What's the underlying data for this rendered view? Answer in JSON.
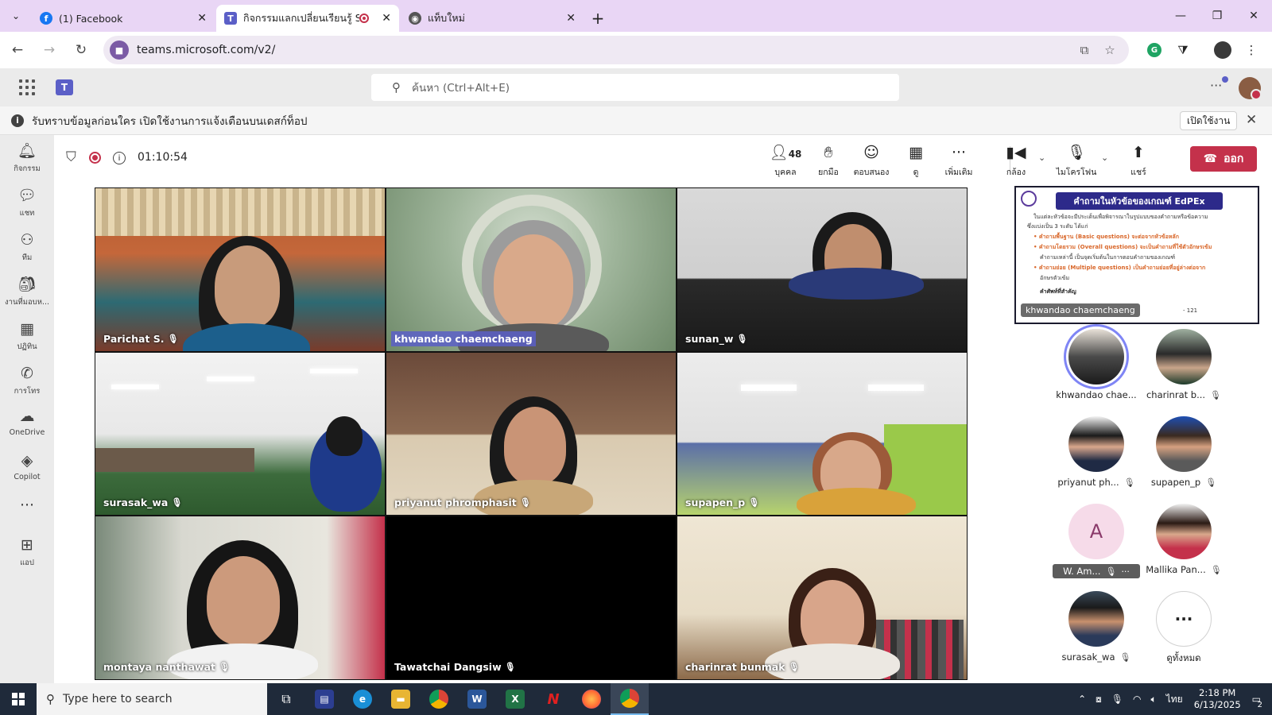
{
  "browser": {
    "tabs": [
      {
        "title": "(1) Facebook",
        "favicon": "facebook-icon"
      },
      {
        "title": "กิจกรรมแลกเปลี่ยนเรียนรู้ SAR",
        "favicon": "teams-icon"
      },
      {
        "title": "แท็บใหม่",
        "favicon": "chrome-icon"
      }
    ],
    "url": "teams.microsoft.com/v2/"
  },
  "teams": {
    "search_placeholder": "ค้นหา (Ctrl+Alt+E)"
  },
  "notification": {
    "text": "รับทราบข้อมูลก่อนใคร เปิดใช้งานการแจ้งเตือนบนเดสก์ท็อป",
    "enable_label": "เปิดใช้งาน"
  },
  "rail": [
    {
      "label": "กิจกรรม",
      "icon": "bell-icon"
    },
    {
      "label": "แชท",
      "icon": "chat-icon"
    },
    {
      "label": "ทีม",
      "icon": "teams-group-icon"
    },
    {
      "label": "งานที่มอบห...",
      "icon": "assignments-icon"
    },
    {
      "label": "ปฏิทิน",
      "icon": "calendar-icon"
    },
    {
      "label": "การโทร",
      "icon": "phone-icon"
    },
    {
      "label": "OneDrive",
      "icon": "cloud-icon"
    },
    {
      "label": "Copilot",
      "icon": "copilot-icon"
    },
    {
      "label": "แอป",
      "icon": "add-app-icon"
    }
  ],
  "meeting": {
    "timer": "01:10:54",
    "people_count": "48",
    "tools": {
      "people": "บุคคล",
      "raise": "ยกมือ",
      "react": "ตอบสนอง",
      "view": "ดู",
      "more": "เพิ่มเติม",
      "camera": "กล้อง",
      "mic": "ไมโครโฟน",
      "share": "แชร์",
      "leave": "ออก"
    },
    "tiles": [
      {
        "name": "Parichat S."
      },
      {
        "name": "khwandao chaemchaeng"
      },
      {
        "name": "sunan_w"
      },
      {
        "name": "surasak_wa"
      },
      {
        "name": "priyanut phromphasit"
      },
      {
        "name": "supapen_p"
      },
      {
        "name": "montaya nanthawat"
      },
      {
        "name": "Tawatchai Dangsiw"
      },
      {
        "name": "charinrat bunmak"
      }
    ],
    "share": {
      "title": "คำถามในหัวข้อของเกณฑ์ EdPEx",
      "presenter": "khwandao chaemchaeng",
      "lines": [
        "ในแต่ละหัวข้อจะมีประเด็นเพื่อพิจารณาในรูปแบบของคำถามหรือข้อความ",
        "ซึ่งแบ่งเป็น 3 ระดับ ได้แก่",
        "• คำถามพื้นฐาน (Basic questions) จะต่อจากหัวข้อหลัก",
        "• คำถามโดยรวม (Overall questions) จะเป็นคำถามที่ใช้ตัวอักษรเข้ม",
        "คำถามเหล่านี้ เป็นจุดเริ่มต้นในการตอบคำถามของเกณฑ์",
        "• คำถามย่อย (Multiple questions) เป็นคำถามย่อยที่อยู่ล่างต่อจาก",
        "อักษรตัวเข้ม",
        "คำศัพท์ที่สำคัญ",
        "- 121"
      ]
    },
    "roster": [
      {
        "label": "khwandao chae..."
      },
      {
        "label": "charinrat b..."
      },
      {
        "label": "priyanut ph..."
      },
      {
        "label": "supapen_p"
      },
      {
        "label": "W. Am...",
        "initial": "A"
      },
      {
        "label": "Mallika Pan..."
      },
      {
        "label": "surasak_wa"
      },
      {
        "label": "ดูทั้งหมด"
      }
    ]
  },
  "taskbar": {
    "search_placeholder": "Type here to search",
    "lang": "ไทย",
    "time": "2:18 PM",
    "date": "6/13/2025",
    "notif_count": "2"
  }
}
